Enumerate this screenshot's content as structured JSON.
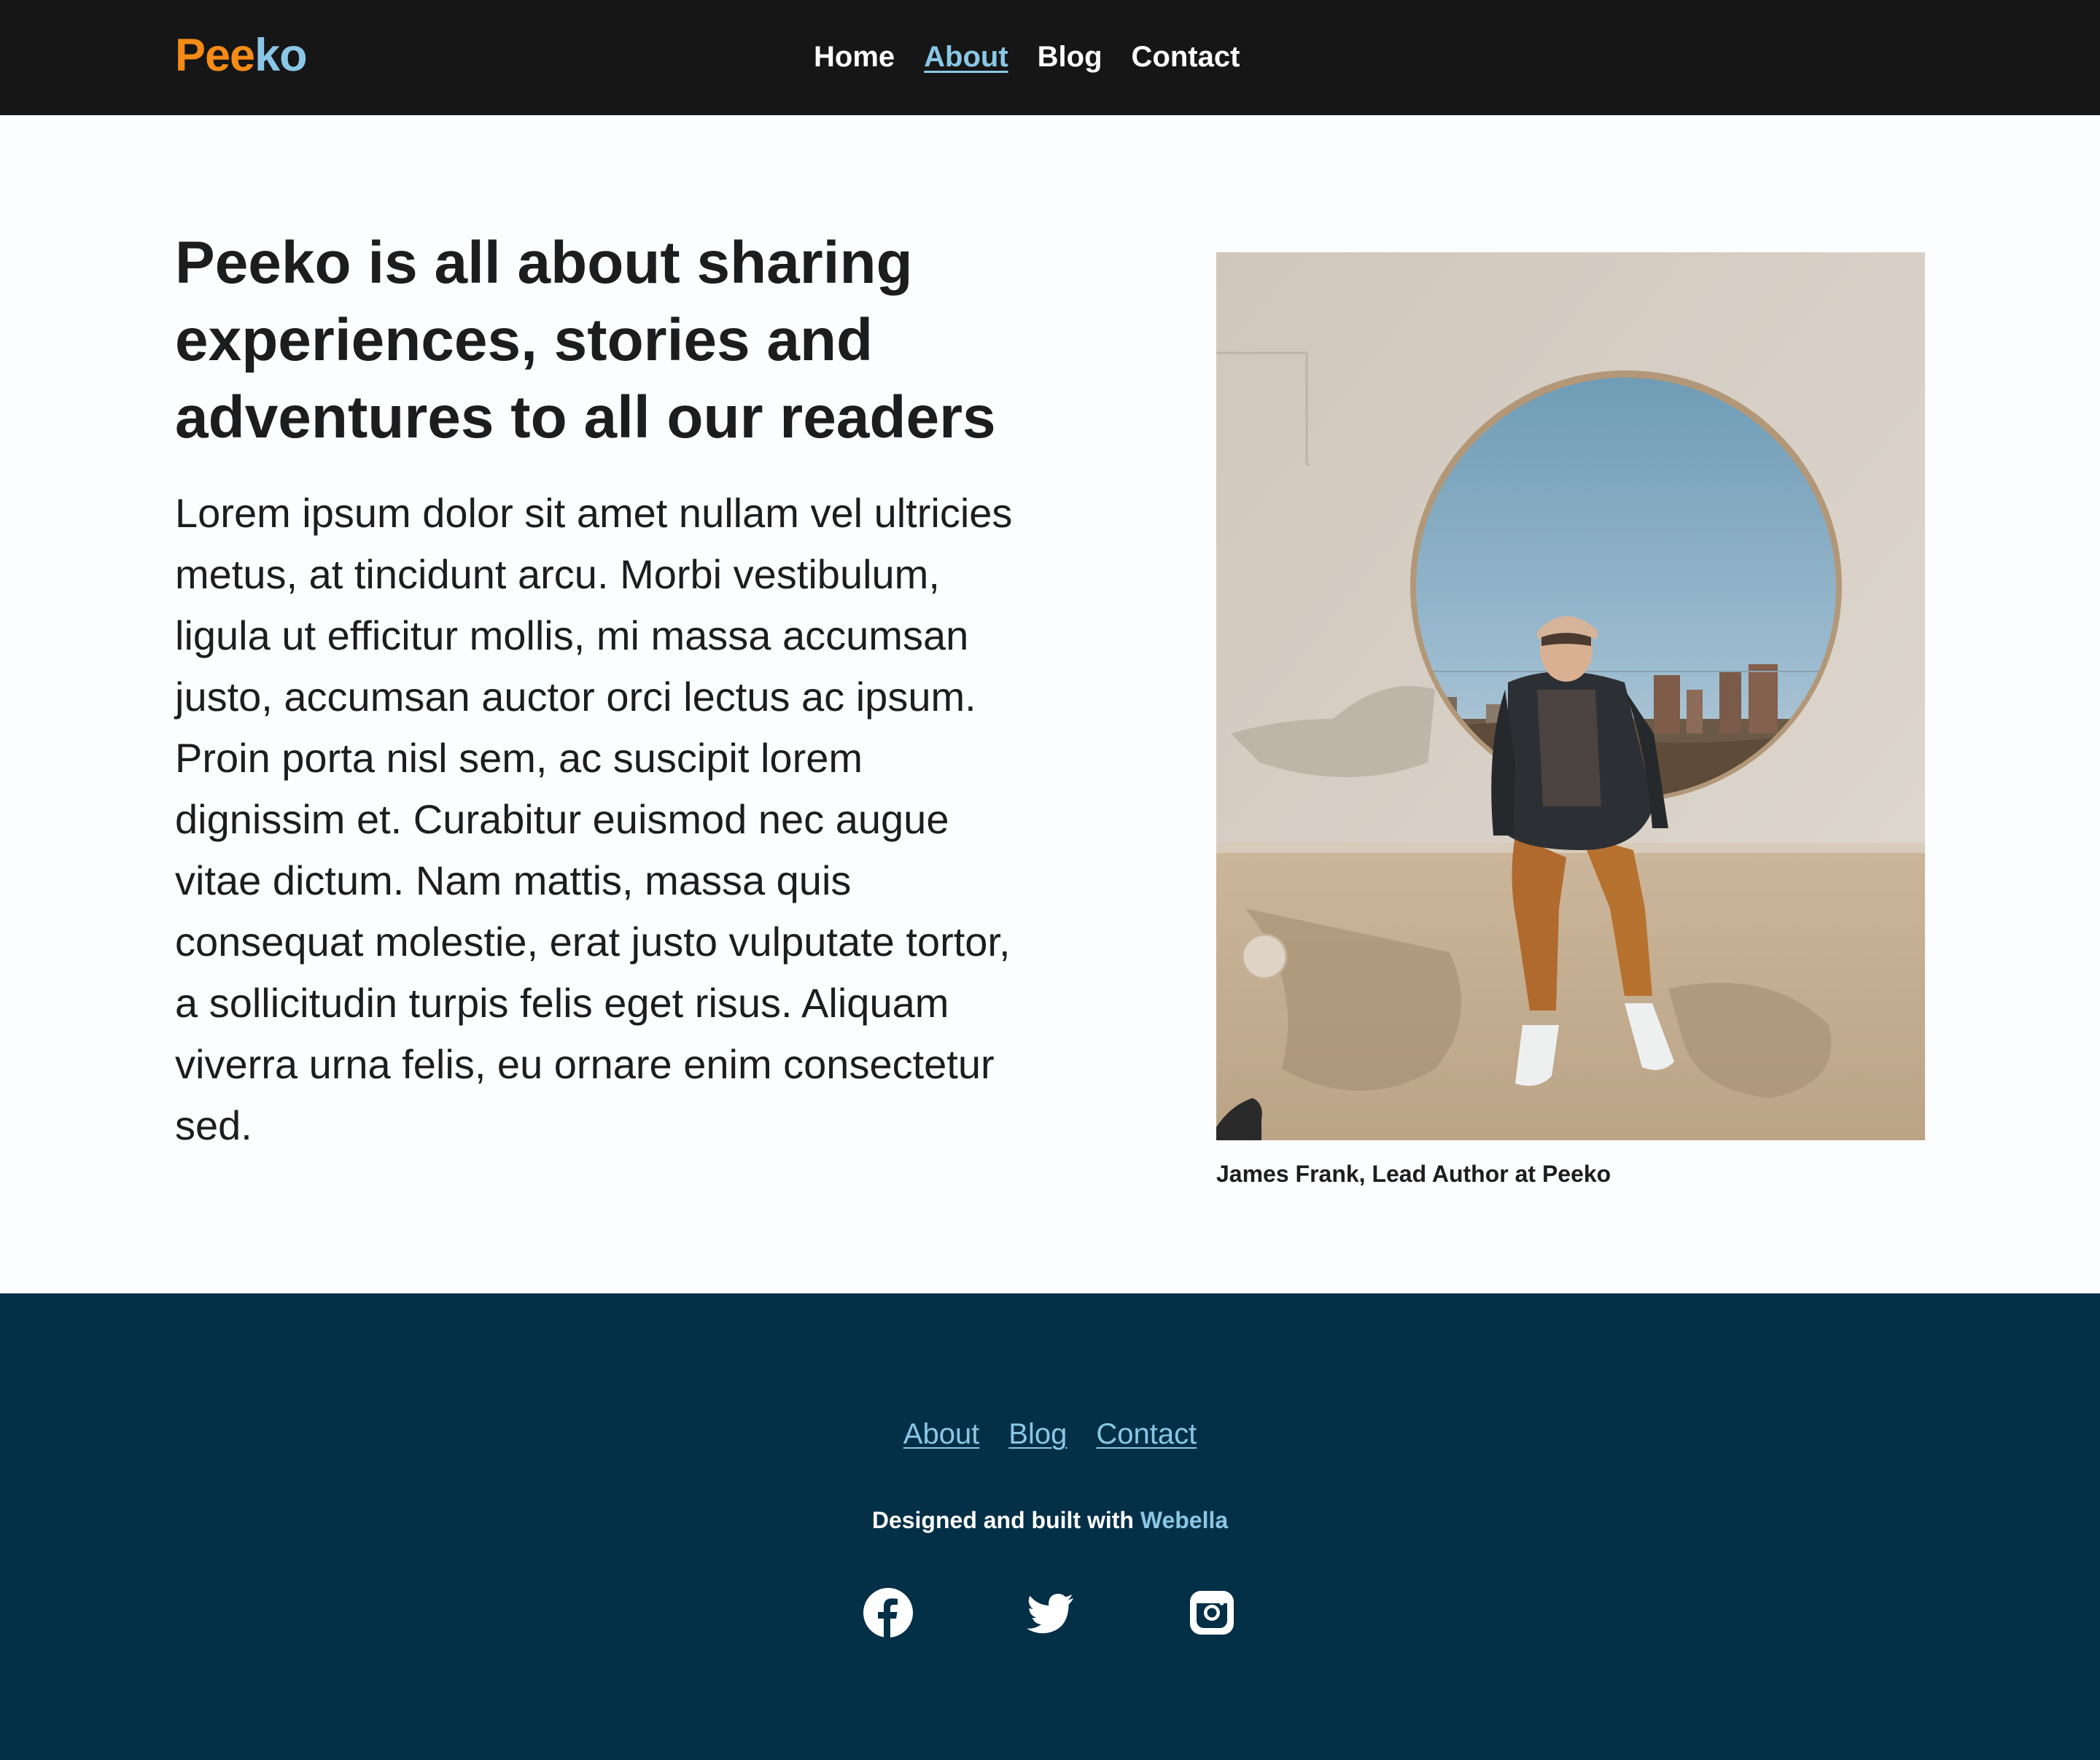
{
  "brand": {
    "part_a": "Pee",
    "part_b": "ko",
    "color_a": "#f58b17",
    "color_b": "#8ac7e6"
  },
  "nav": {
    "items": [
      {
        "label": "Home",
        "active": false
      },
      {
        "label": "About",
        "active": true
      },
      {
        "label": "Blog",
        "active": false
      },
      {
        "label": "Contact",
        "active": false
      }
    ]
  },
  "hero": {
    "title": "Peeko is all about sharing experiences, stories and adventures to all our readers",
    "body": "Lorem ipsum dolor sit amet nullam vel ultricies metus, at tincidunt arcu. Morbi vestibulum, ligula ut efficitur mollis, mi massa accumsan justo, accumsan auctor orci lectus ac ipsum. Proin porta nisl sem, ac suscipit lorem dignissim et. Curabitur euismod nec augue vitae dictum. Nam mattis, massa quis consequat molestie, erat justo vulputate tortor, a sollicitudin turpis felis eget risus. Aliquam viverra urna felis, eu ornare enim consectetur sed.",
    "caption": "James Frank, Lead Author at Peeko"
  },
  "footer": {
    "links": [
      {
        "label": "About"
      },
      {
        "label": "Blog"
      },
      {
        "label": "Contact"
      }
    ],
    "credit_prefix": "Designed and built with",
    "credit_link": "Webella",
    "social_icons": [
      "facebook-icon",
      "twitter-icon",
      "instagram-icon"
    ]
  },
  "colors": {
    "header_bg": "#161616",
    "page_bg": "#fbfdff",
    "footer_bg": "#032f47",
    "accent": "#8ac7e6",
    "text": "#1d1d1d"
  }
}
